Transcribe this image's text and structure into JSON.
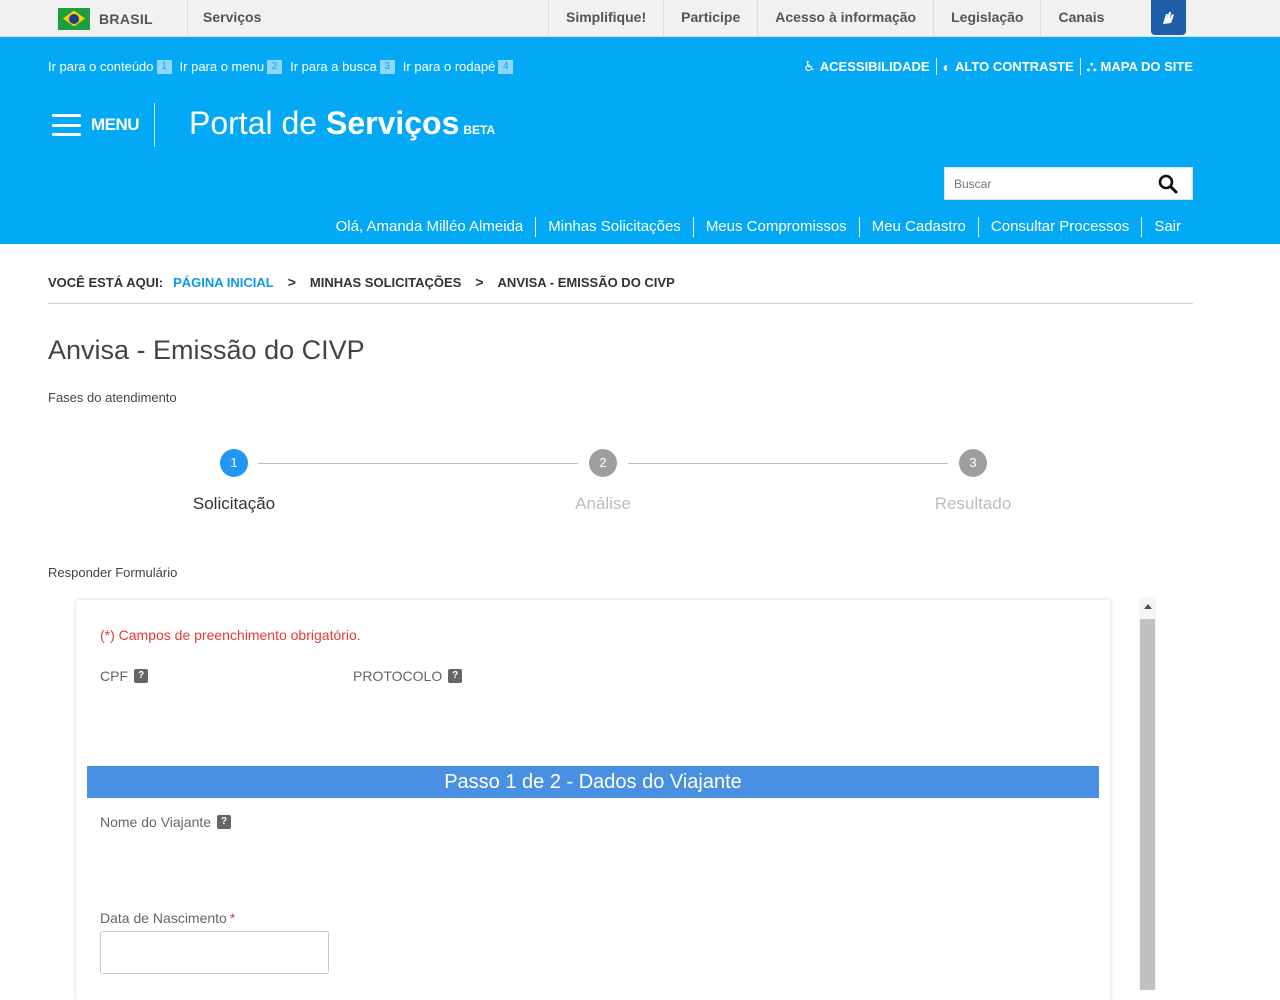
{
  "govbar": {
    "brasil_label": "BRASIL",
    "servicos_label": "Serviços",
    "links": [
      "Simplifique!",
      "Participe",
      "Acesso à informação",
      "Legislação",
      "Canais"
    ]
  },
  "header": {
    "skip_links": [
      {
        "label": "Ir para o conteúdo",
        "key": "1"
      },
      {
        "label": "Ir para o menu",
        "key": "2"
      },
      {
        "label": "Ir para a busca",
        "key": "3"
      },
      {
        "label": "Ir para o rodapé",
        "key": "4"
      }
    ],
    "accessibility": [
      {
        "label": "ACESSIBILIDADE",
        "icon": "wheelchair-icon"
      },
      {
        "label": "ALTO CONTRASTE",
        "icon": "contrast-icon"
      },
      {
        "label": "MAPA DO SITE",
        "icon": "sitemap-icon"
      }
    ],
    "menu_label": "MENU",
    "portal_title_thin": "Portal de",
    "portal_title_bold": "Serviços",
    "portal_beta": "BETA",
    "search_placeholder": "Buscar",
    "user_nav": [
      "Olá, Amanda Milléo Almeida",
      "Minhas Solicitações",
      "Meus Compromissos",
      "Meu Cadastro",
      "Consultar Processos",
      "Sair"
    ]
  },
  "breadcrumb": {
    "prefix": "VOCÊ ESTÁ AQUI:",
    "items": [
      "PÁGINA INICIAL",
      "MINHAS SOLICITAÇÕES",
      "ANVISA - EMISSÃO DO CIVP"
    ]
  },
  "main": {
    "title": "Anvisa - Emissão do CIVP",
    "phases_label": "Fases do atendimento",
    "steps": [
      {
        "number": "1",
        "label": "Solicitação",
        "active": true
      },
      {
        "number": "2",
        "label": "Análise",
        "active": false
      },
      {
        "number": "3",
        "label": "Resultado",
        "active": false
      }
    ],
    "form_label": "Responder Formulário"
  },
  "form": {
    "required_notice": "(*) Campos de preenchimento obrigatório.",
    "cpf_label": "CPF",
    "protocolo_label": "PROTOCOLO",
    "help_glyph": "?",
    "step_title": "Passo 1 de 2 - Dados do Viajante",
    "nome_label": "Nome do Viajante",
    "nascimento_label": "Data de Nascimento",
    "required_mark": "*"
  },
  "colors": {
    "header_blue": "#03a9f4",
    "step_active": "#2196f3",
    "step_idle": "#9e9e9e",
    "step_bar": "#4a90e2",
    "required_red": "#e53935",
    "link_blue": "#0b9be6"
  }
}
